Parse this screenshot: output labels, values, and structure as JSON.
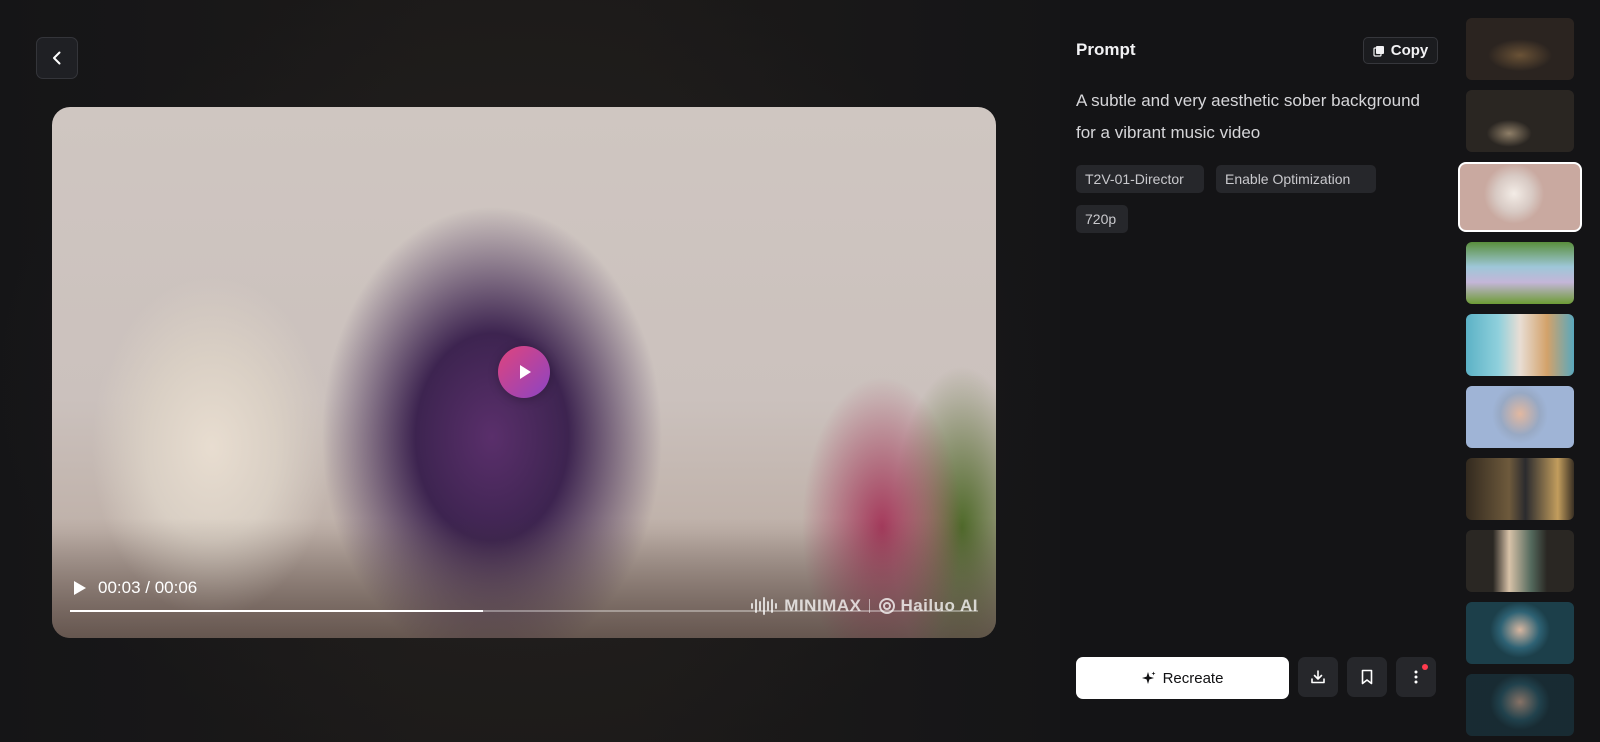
{
  "player": {
    "time_display": "00:03 / 00:06",
    "progress_fraction": 0.455,
    "watermark": {
      "left": "MINIMAX",
      "right": "Hailuo AI"
    }
  },
  "prompt": {
    "title": "Prompt",
    "copy_label": "Copy",
    "text": "A subtle and very aesthetic sober background for a vibrant music video",
    "tags": [
      "T2V-01-Director",
      "Enable Optimization",
      "720p"
    ]
  },
  "actions": {
    "recreate_label": "Recreate"
  },
  "thumbnails": {
    "count": 10,
    "selected_index": 2
  },
  "icons": [
    "chevron-left-icon",
    "play-icon",
    "copy-icon",
    "sparkle-icon",
    "download-icon",
    "bookmark-icon",
    "more-vertical-icon"
  ],
  "colors": {
    "accent_gradient_start": "#e0447c",
    "accent_gradient_end": "#8b44c4",
    "notification_dot": "#ff3b4e"
  }
}
